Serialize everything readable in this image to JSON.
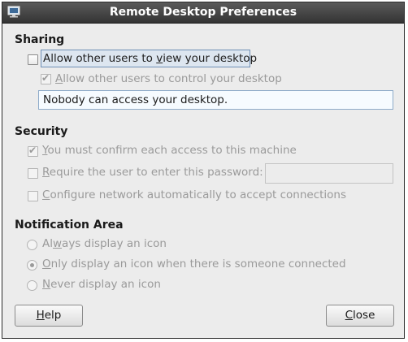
{
  "window": {
    "title": "Remote Desktop Preferences"
  },
  "sharing": {
    "heading": "Sharing",
    "allow_view": {
      "pre": "Allow other users to ",
      "mnemonic": "v",
      "post": "iew your desktop",
      "checked": false
    },
    "allow_control": {
      "pre": "",
      "mnemonic": "A",
      "post": "llow other users to control your desktop",
      "checked": true,
      "enabled": false
    },
    "status_text": "Nobody can access your desktop."
  },
  "security": {
    "heading": "Security",
    "confirm": {
      "pre": "",
      "mnemonic": "Y",
      "post": "ou must confirm each access to this machine",
      "checked": true,
      "enabled": false
    },
    "password": {
      "pre": "",
      "mnemonic": "R",
      "post": "equire the user to enter this password:",
      "checked": false,
      "enabled": false,
      "value": ""
    },
    "network": {
      "pre": "",
      "mnemonic": "C",
      "post": "onfigure network automatically to accept connections",
      "checked": false,
      "enabled": false
    }
  },
  "notification": {
    "heading": "Notification Area",
    "always": {
      "pre": "Al",
      "mnemonic": "w",
      "post": "ays display an icon",
      "selected": false
    },
    "only_connected": {
      "pre": "",
      "mnemonic": "O",
      "post": "nly display an icon when there is someone connected",
      "selected": true
    },
    "never": {
      "pre": "",
      "mnemonic": "N",
      "post": "ever display an icon",
      "selected": false
    }
  },
  "buttons": {
    "help": {
      "pre": "",
      "mnemonic": "H",
      "post": "elp"
    },
    "close": {
      "pre": "",
      "mnemonic": "C",
      "post": "lose"
    }
  }
}
